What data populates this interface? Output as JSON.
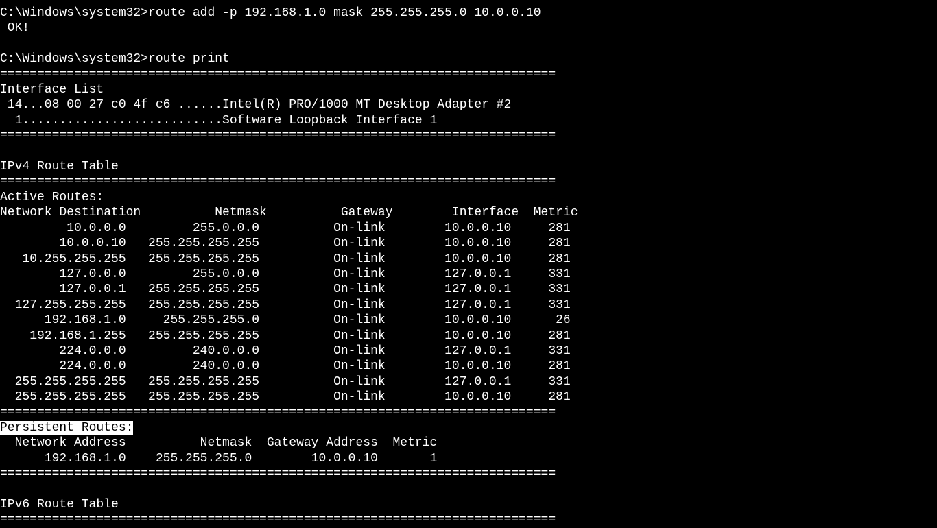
{
  "prompt1": "C:\\Windows\\system32>",
  "cmd1": "route add -p 192.168.1.0 mask 255.255.255.0 10.0.0.10",
  "ok": " OK!",
  "prompt2": "C:\\Windows\\system32>",
  "cmd2": "route print",
  "divider": "===========================================================================",
  "iface_title": "Interface List",
  "iface_line1": " 14...08 00 27 c0 4f c6 ......Intel(R) PRO/1000 MT Desktop Adapter #2",
  "iface_line2": "  1...........................Software Loopback Interface 1",
  "ipv4_title": "IPv4 Route Table",
  "active_title": "Active Routes:",
  "active_header": {
    "c0": "Network Destination",
    "c1": "Netmask",
    "c2": "Gateway",
    "c3": "Interface",
    "c4": "Metric"
  },
  "active_rows": [
    {
      "c0": "10.0.0.0",
      "c1": "255.0.0.0",
      "c2": "On-link",
      "c3": "10.0.0.10",
      "c4": "281"
    },
    {
      "c0": "10.0.0.10",
      "c1": "255.255.255.255",
      "c2": "On-link",
      "c3": "10.0.0.10",
      "c4": "281"
    },
    {
      "c0": "10.255.255.255",
      "c1": "255.255.255.255",
      "c2": "On-link",
      "c3": "10.0.0.10",
      "c4": "281"
    },
    {
      "c0": "127.0.0.0",
      "c1": "255.0.0.0",
      "c2": "On-link",
      "c3": "127.0.0.1",
      "c4": "331"
    },
    {
      "c0": "127.0.0.1",
      "c1": "255.255.255.255",
      "c2": "On-link",
      "c3": "127.0.0.1",
      "c4": "331"
    },
    {
      "c0": "127.255.255.255",
      "c1": "255.255.255.255",
      "c2": "On-link",
      "c3": "127.0.0.1",
      "c4": "331"
    },
    {
      "c0": "192.168.1.0",
      "c1": "255.255.255.0",
      "c2": "On-link",
      "c3": "10.0.0.10",
      "c4": "26"
    },
    {
      "c0": "192.168.1.255",
      "c1": "255.255.255.255",
      "c2": "On-link",
      "c3": "10.0.0.10",
      "c4": "281"
    },
    {
      "c0": "224.0.0.0",
      "c1": "240.0.0.0",
      "c2": "On-link",
      "c3": "127.0.0.1",
      "c4": "331"
    },
    {
      "c0": "224.0.0.0",
      "c1": "240.0.0.0",
      "c2": "On-link",
      "c3": "10.0.0.10",
      "c4": "281"
    },
    {
      "c0": "255.255.255.255",
      "c1": "255.255.255.255",
      "c2": "On-link",
      "c3": "127.0.0.1",
      "c4": "331"
    },
    {
      "c0": "255.255.255.255",
      "c1": "255.255.255.255",
      "c2": "On-link",
      "c3": "10.0.0.10",
      "c4": "281"
    }
  ],
  "persistent_title": "Persistent Routes:",
  "persistent_header": {
    "c0": "Network Address",
    "c1": "Netmask",
    "c2": "Gateway Address",
    "c3": "Metric"
  },
  "persistent_rows": [
    {
      "c0": "192.168.1.0",
      "c1": "255.255.255.0",
      "c2": "10.0.0.10",
      "c3": "1"
    }
  ],
  "ipv6_title": "IPv6 Route Table"
}
